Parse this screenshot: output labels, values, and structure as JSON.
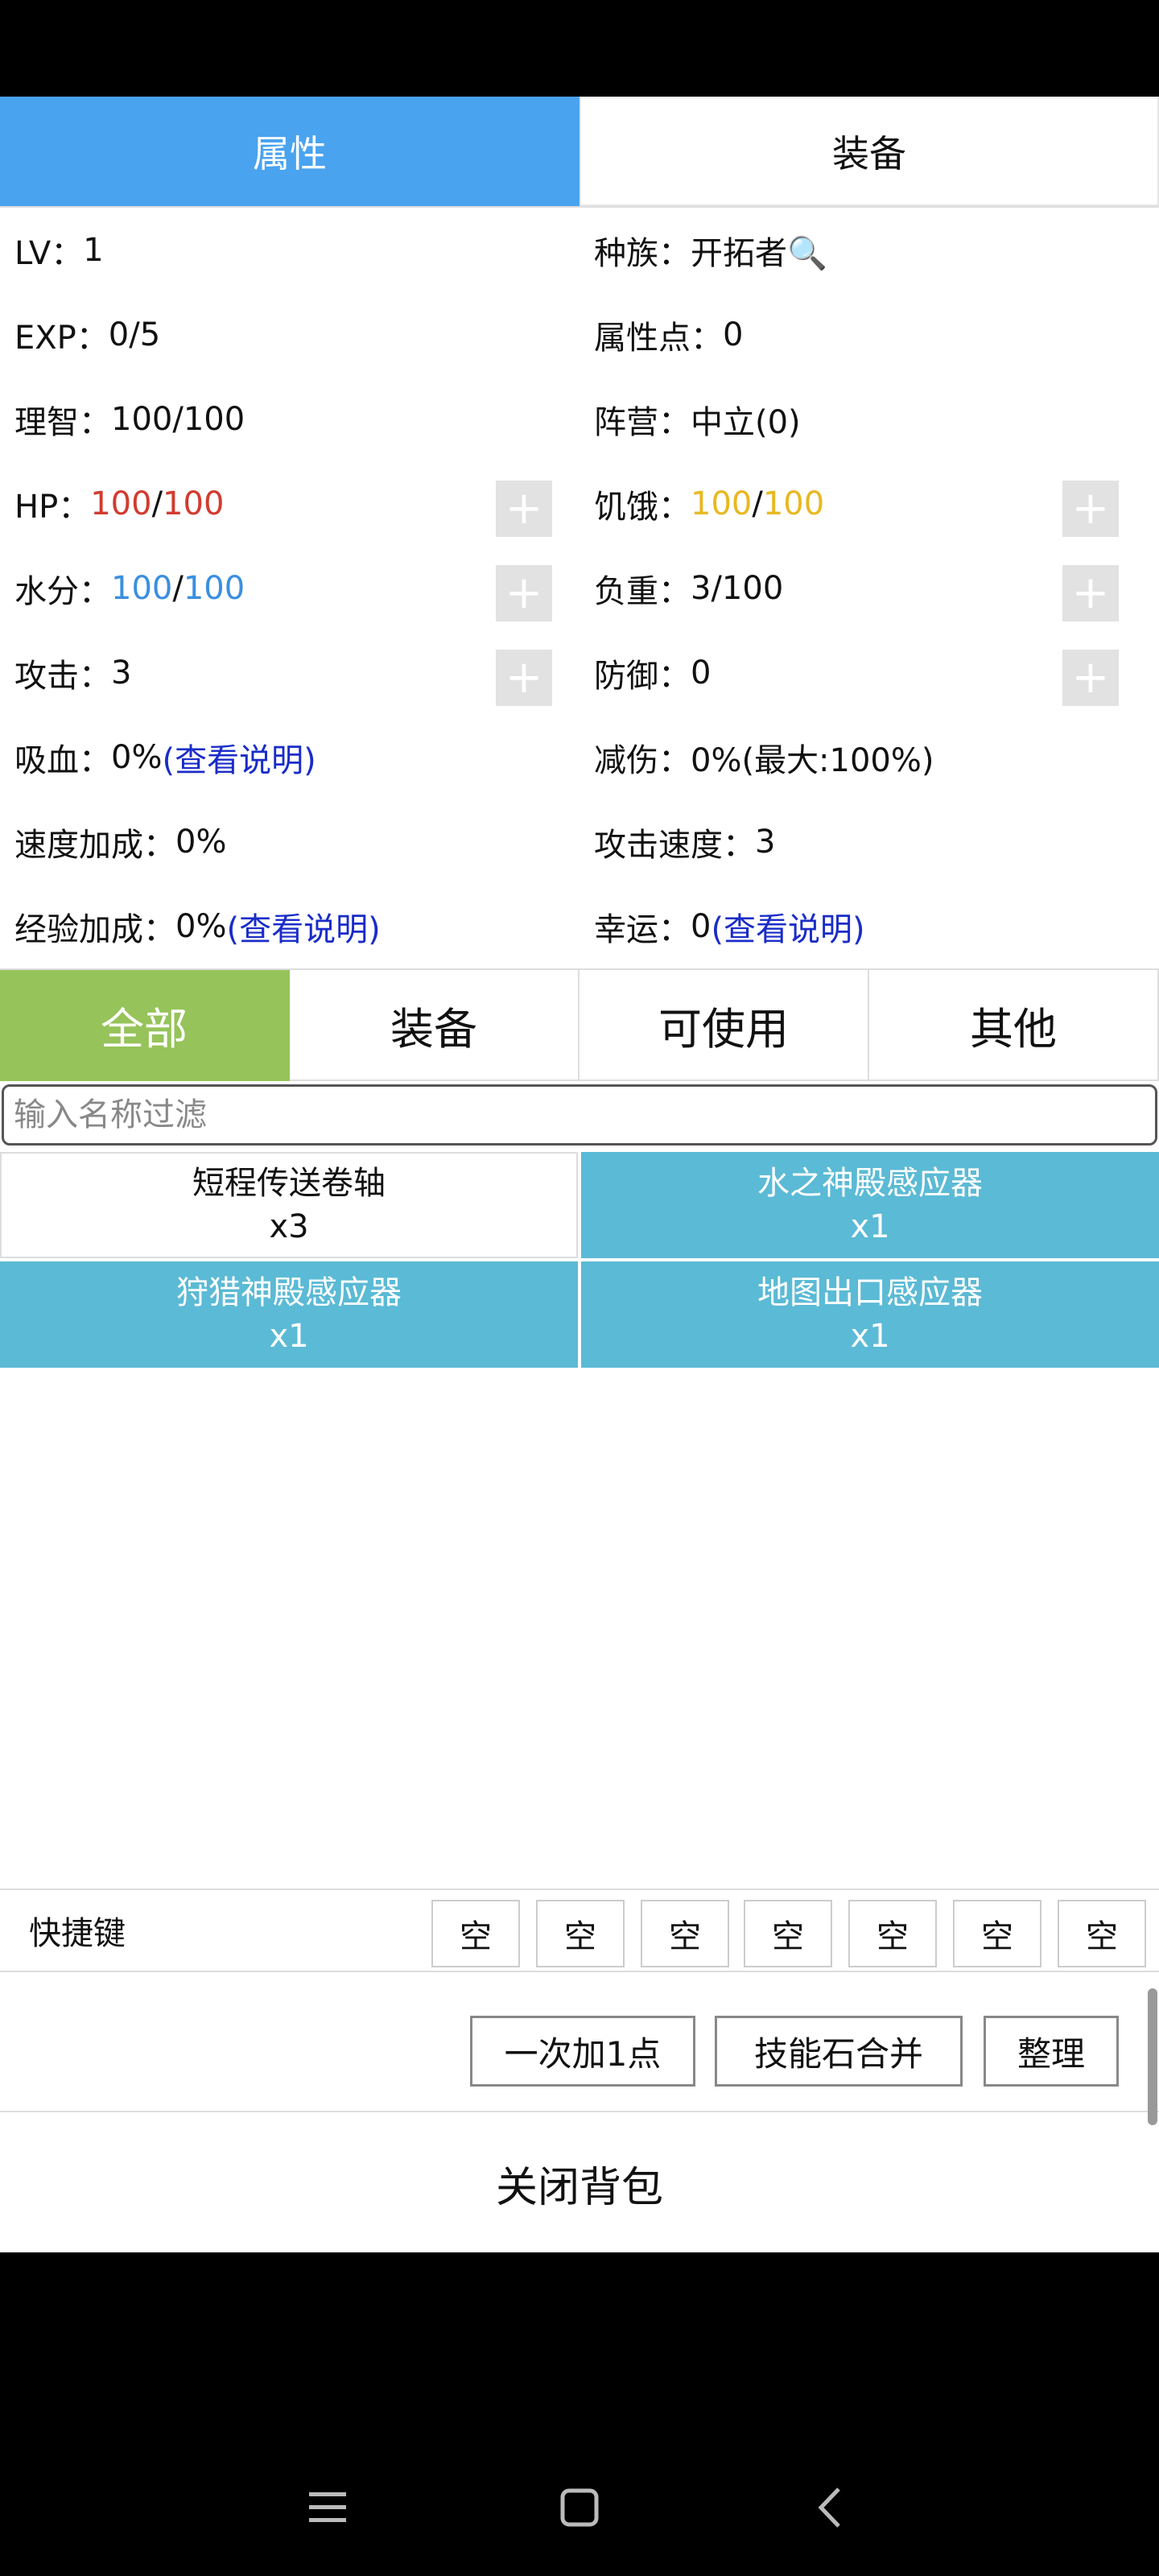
{
  "top_tabs": [
    {
      "label": "属性",
      "active": true
    },
    {
      "label": "装备",
      "active": false
    }
  ],
  "stats": {
    "lv_label": "LV：",
    "lv": "1",
    "race_label": "种族：",
    "race": "开拓者🔍",
    "exp_label": "EXP：",
    "exp": "0/5",
    "points_label": "属性点：",
    "points": "0",
    "sanity_label": "理智：",
    "sanity": "100/100",
    "camp_label": "阵营：",
    "camp": "中立(0)",
    "hp_label": "HP：",
    "hp_cur": "100",
    "hp_max": "100",
    "hunger_label": "饥饿：",
    "hunger_cur": "100",
    "hunger_max": "100",
    "water_label": "水分：",
    "water_cur": "100",
    "water_max": "100",
    "load_label": "负重：",
    "load": "3/100",
    "atk_label": "攻击：",
    "atk": "3",
    "def_label": "防御：",
    "def": "0",
    "lifesteal_label": "吸血：",
    "lifesteal": "0%",
    "dmgred_label": "减伤：",
    "dmgred": "0%(最大:100%)",
    "speed_label": "速度加成：",
    "speed": "0%",
    "atkspeed_label": "攻击速度：",
    "atkspeed": "3",
    "expbonus_label": "经验加成：",
    "expbonus": "0%",
    "luck_label": "幸运：",
    "luck": "0",
    "see_desc": "(查看说明)",
    "slash": "/",
    "plus": "+"
  },
  "category_tabs": [
    {
      "label": "全部",
      "active": true
    },
    {
      "label": "装备",
      "active": false
    },
    {
      "label": "可使用",
      "active": false
    },
    {
      "label": "其他",
      "active": false
    }
  ],
  "filter": {
    "placeholder": "输入名称过滤",
    "value": ""
  },
  "items": [
    {
      "name": "短程传送卷轴",
      "count": "x3",
      "highlight": false
    },
    {
      "name": "水之神殿感应器",
      "count": "x1",
      "highlight": true
    },
    {
      "name": "狩猎神殿感应器",
      "count": "x1",
      "highlight": true
    },
    {
      "name": "地图出口感应器",
      "count": "x1",
      "highlight": true
    }
  ],
  "shortcut": {
    "label": "快捷键",
    "slots": [
      "空",
      "空",
      "空",
      "空",
      "空",
      "空",
      "空"
    ]
  },
  "actions": {
    "add_one": "一次加1点",
    "merge": "技能石合并",
    "sort": "整理"
  },
  "close_label": "关闭背包",
  "colors": {
    "tab_active": "#4aa3ef",
    "category_active": "#96c35a",
    "item_highlight": "#5bbad5",
    "hp": "#d23b2f",
    "water": "#3b8fe0",
    "hunger": "#e8b820",
    "link": "#1a2cc8"
  },
  "nav_icons": [
    "menu-icon",
    "home-icon",
    "back-icon"
  ]
}
